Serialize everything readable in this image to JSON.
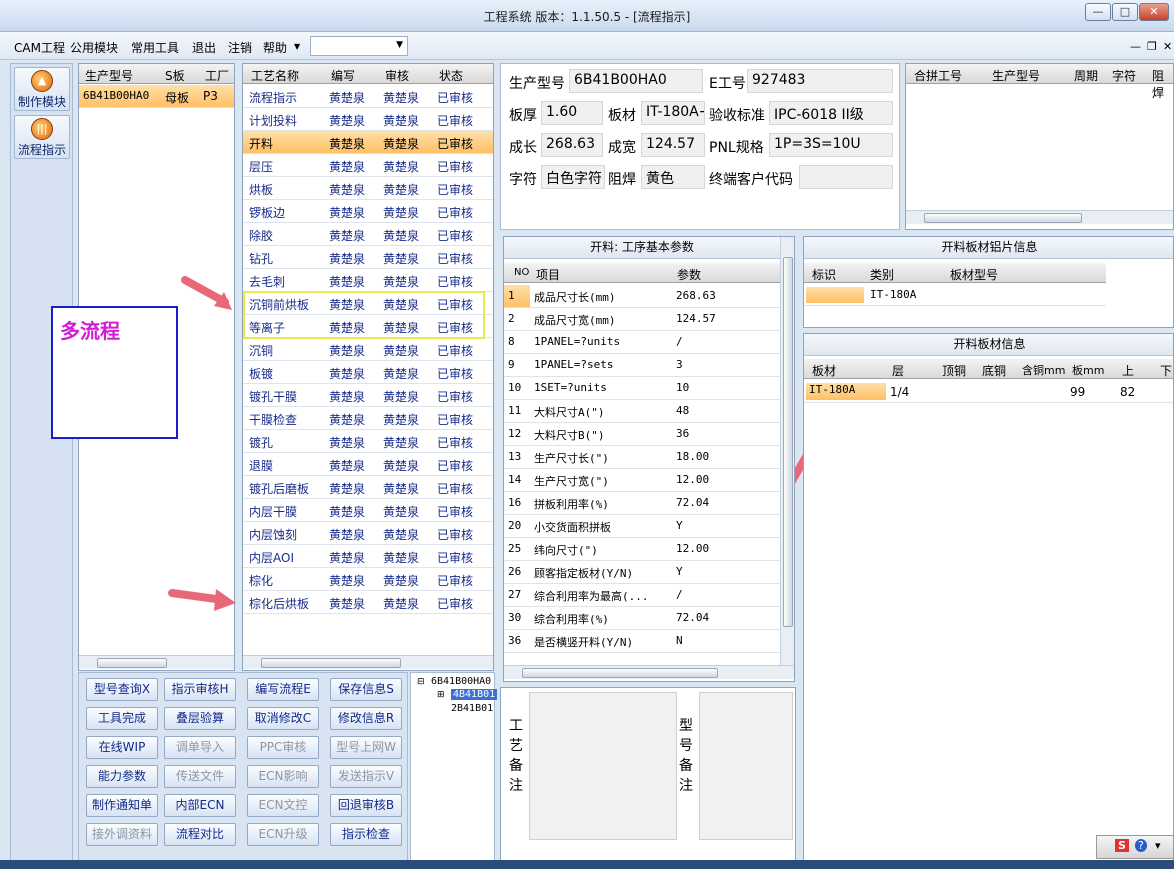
{
  "window": {
    "title": "工程系统   版本：1.1.50.5 - [流程指示]"
  },
  "menu": {
    "items": [
      "CAM工程",
      "公用模块",
      "常用工具",
      "退出",
      "注销",
      "帮助"
    ],
    "combo_value": ""
  },
  "leftbar": {
    "buttons": [
      {
        "label": "制作模块",
        "icon": "flame-icon"
      },
      {
        "label": "流程指示",
        "icon": "bars-icon"
      }
    ]
  },
  "model_grid": {
    "headers": [
      "生产型号",
      "S板",
      "工厂"
    ],
    "rows": [
      {
        "model": "6B41B00HA0",
        "s_board": "母板",
        "factory": "P3"
      }
    ]
  },
  "process_grid": {
    "headers": [
      "工艺名称",
      "编写",
      "审核",
      "状态"
    ],
    "rows": [
      {
        "name": "流程指示",
        "writer": "黄楚泉",
        "auditor": "黄楚泉",
        "status": "已审核"
      },
      {
        "name": "计划投料",
        "writer": "黄楚泉",
        "auditor": "黄楚泉",
        "status": "已审核"
      },
      {
        "name": "开料",
        "writer": "黄楚泉",
        "auditor": "黄楚泉",
        "status": "已审核"
      },
      {
        "name": "层压",
        "writer": "黄楚泉",
        "auditor": "黄楚泉",
        "status": "已审核"
      },
      {
        "name": "烘板",
        "writer": "黄楚泉",
        "auditor": "黄楚泉",
        "status": "已审核"
      },
      {
        "name": "锣板边",
        "writer": "黄楚泉",
        "auditor": "黄楚泉",
        "status": "已审核"
      },
      {
        "name": "除胶",
        "writer": "黄楚泉",
        "auditor": "黄楚泉",
        "status": "已审核"
      },
      {
        "name": "钻孔",
        "writer": "黄楚泉",
        "auditor": "黄楚泉",
        "status": "已审核"
      },
      {
        "name": "去毛刺",
        "writer": "黄楚泉",
        "auditor": "黄楚泉",
        "status": "已审核"
      },
      {
        "name": "沉铜前烘板",
        "writer": "黄楚泉",
        "auditor": "黄楚泉",
        "status": "已审核"
      },
      {
        "name": "等离子",
        "writer": "黄楚泉",
        "auditor": "黄楚泉",
        "status": "已审核"
      },
      {
        "name": "沉铜",
        "writer": "黄楚泉",
        "auditor": "黄楚泉",
        "status": "已审核"
      },
      {
        "name": "板镀",
        "writer": "黄楚泉",
        "auditor": "黄楚泉",
        "status": "已审核"
      },
      {
        "name": "镀孔干膜",
        "writer": "黄楚泉",
        "auditor": "黄楚泉",
        "status": "已审核"
      },
      {
        "name": "干膜检查",
        "writer": "黄楚泉",
        "auditor": "黄楚泉",
        "status": "已审核"
      },
      {
        "name": "镀孔",
        "writer": "黄楚泉",
        "auditor": "黄楚泉",
        "status": "已审核"
      },
      {
        "name": "退膜",
        "writer": "黄楚泉",
        "auditor": "黄楚泉",
        "status": "已审核"
      },
      {
        "name": "镀孔后磨板",
        "writer": "黄楚泉",
        "auditor": "黄楚泉",
        "status": "已审核"
      },
      {
        "name": "内层干膜",
        "writer": "黄楚泉",
        "auditor": "黄楚泉",
        "status": "已审核"
      },
      {
        "name": "内层蚀刻",
        "writer": "黄楚泉",
        "auditor": "黄楚泉",
        "status": "已审核"
      },
      {
        "name": "内层AOI",
        "writer": "黄楚泉",
        "auditor": "黄楚泉",
        "status": "已审核"
      },
      {
        "name": "棕化",
        "writer": "黄楚泉",
        "auditor": "黄楚泉",
        "status": "已审核"
      },
      {
        "name": "棕化后烘板",
        "writer": "黄楚泉",
        "auditor": "黄楚泉",
        "status": "已审核"
      }
    ]
  },
  "annotation": {
    "label": "多流程"
  },
  "action_buttons": [
    {
      "label": "型号查询X",
      "disabled": false
    },
    {
      "label": "指示审核H",
      "disabled": false
    },
    {
      "label": "编写流程E",
      "disabled": false
    },
    {
      "label": "保存信息S",
      "disabled": false
    },
    {
      "label": "工具完成",
      "disabled": false
    },
    {
      "label": "叠层验算",
      "disabled": false
    },
    {
      "label": "取消修改C",
      "disabled": false
    },
    {
      "label": "修改信息R",
      "disabled": false
    },
    {
      "label": "在线WIP",
      "disabled": false
    },
    {
      "label": "调单导入",
      "disabled": true
    },
    {
      "label": "PPC审核",
      "disabled": true
    },
    {
      "label": "型号上网W",
      "disabled": true
    },
    {
      "label": "能力参数",
      "disabled": false
    },
    {
      "label": "传送文件",
      "disabled": true
    },
    {
      "label": "ECN影响",
      "disabled": true
    },
    {
      "label": "发送指示V",
      "disabled": true
    },
    {
      "label": "制作通知单",
      "disabled": false
    },
    {
      "label": "内部ECN",
      "disabled": false
    },
    {
      "label": "ECN文控",
      "disabled": true
    },
    {
      "label": "回退审核B",
      "disabled": false
    },
    {
      "label": "接外调资料",
      "disabled": true
    },
    {
      "label": "流程对比",
      "disabled": false
    },
    {
      "label": "ECN升级",
      "disabled": true
    },
    {
      "label": "指示检查",
      "disabled": false
    }
  ],
  "tree": {
    "root": "6B41B00HA0",
    "children": [
      "4B41B01",
      "2B41B01"
    ]
  },
  "info": {
    "model_label": "生产型号",
    "model_value": "6B41B00HA0",
    "eng_label": "E工号",
    "eng_value": "927483",
    "thick_label": "板厚",
    "thick_value": "1.60",
    "material_label": "板材",
    "material_value": "IT-180A+",
    "standard_label": "验收标准",
    "standard_value": "IPC-6018 II级",
    "len_label": "成长",
    "len_value": "268.63",
    "wid_label": "成宽",
    "wid_value": "124.57",
    "pnl_label": "PNL规格",
    "pnl_value": "1P=3S=10U",
    "char_label": "字符",
    "char_value": "白色字符",
    "mask_label": "阻焊",
    "mask_value": "黄色",
    "cust_label": "终端客户代码",
    "cust_value": ""
  },
  "combine_grid": {
    "headers": [
      "合拼工号",
      "生产型号",
      "周期",
      "字符",
      "阻焊"
    ]
  },
  "params": {
    "title": "开料: 工序基本参数",
    "headers": [
      "NO",
      "项目",
      "参数"
    ],
    "rows": [
      {
        "no": "1",
        "item": "成品尺寸长(mm)",
        "value": "268.63"
      },
      {
        "no": "2",
        "item": "成品尺寸宽(mm)",
        "value": "124.57"
      },
      {
        "no": "8",
        "item": "1PANEL=?units",
        "value": "/"
      },
      {
        "no": "9",
        "item": "1PANEL=?sets",
        "value": "3"
      },
      {
        "no": "10",
        "item": "1SET=?units",
        "value": "10"
      },
      {
        "no": "11",
        "item": "大料尺寸A(\")",
        "value": "48"
      },
      {
        "no": "12",
        "item": "大料尺寸B(\")",
        "value": "36"
      },
      {
        "no": "13",
        "item": "生产尺寸长(\")",
        "value": "18.00"
      },
      {
        "no": "14",
        "item": "生产尺寸宽(\")",
        "value": "12.00"
      },
      {
        "no": "16",
        "item": "拼板利用率(%)",
        "value": "72.04"
      },
      {
        "no": "20",
        "item": "小交货面积拼板",
        "value": "Y"
      },
      {
        "no": "25",
        "item": "纬向尺寸(\")",
        "value": "12.00"
      },
      {
        "no": "26",
        "item": "顾客指定板材(Y/N)",
        "value": "Y"
      },
      {
        "no": "27",
        "item": "综合利用率为最高(...",
        "value": "/"
      },
      {
        "no": "30",
        "item": "综合利用率(%)",
        "value": "72.04"
      },
      {
        "no": "36",
        "item": "是否横竖开料(Y/N)",
        "value": "N"
      }
    ]
  },
  "al_sheet": {
    "title": "开料板材铝片信息",
    "headers": [
      "标识",
      "类别",
      "板材型号"
    ],
    "rows": [
      {
        "mark": "",
        "category": "IT-180A",
        "model": ""
      }
    ]
  },
  "board_info": {
    "title": "开料板材信息",
    "headers": [
      "板材",
      "层",
      "顶铜",
      "底铜",
      "含铜mm",
      "板mm",
      "上",
      "下"
    ],
    "rows": [
      {
        "material": "IT-180A",
        "layer": "1/4",
        "top": "",
        "bottom": "",
        "cu": "",
        "board": "99",
        "up": "82",
        "down": ""
      }
    ]
  },
  "remarks": {
    "process_label": "工艺备注",
    "model_label": "型号备注"
  },
  "colors": {
    "selected_row": "#ffbf66",
    "annotation_text": "#d21ed2",
    "annotation_border": "#1c1cc8",
    "arrow": "#e8687a",
    "highlight": "#e9e94a"
  }
}
